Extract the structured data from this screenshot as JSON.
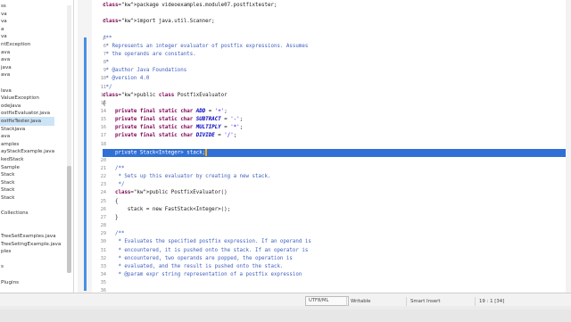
{
  "explorer": {
    "items": [
      {
        "label": "ss",
        "selected": false
      },
      {
        "label": "va",
        "selected": false
      },
      {
        "label": "va",
        "selected": false
      },
      {
        "label": "a",
        "selected": false
      },
      {
        "label": "va",
        "selected": false
      },
      {
        "label": "ntException",
        "selected": false
      },
      {
        "label": "ava",
        "selected": false
      },
      {
        "label": "ava",
        "selected": false
      },
      {
        "label": "java",
        "selected": false
      },
      {
        "label": "ava",
        "selected": false
      },
      {
        "label": "",
        "selected": false
      },
      {
        "label": "Iava",
        "selected": false
      },
      {
        "label": "ValueException",
        "selected": false
      },
      {
        "label": "odeJava",
        "selected": false
      },
      {
        "label": "ostfixEvaluator.java",
        "selected": false
      },
      {
        "label": "ostfixTester.java",
        "selected": true
      },
      {
        "label": "Stackjava",
        "selected": false
      },
      {
        "label": "ava",
        "selected": false
      },
      {
        "label": "amples",
        "selected": false
      },
      {
        "label": "ayStackExample.java",
        "selected": false
      },
      {
        "label": "kedStack",
        "selected": false
      },
      {
        "label": "Sample",
        "selected": false
      },
      {
        "label": "Stack",
        "selected": false
      },
      {
        "label": "Stack",
        "selected": false
      },
      {
        "label": "Stack",
        "selected": false
      },
      {
        "label": "Stack",
        "selected": false
      },
      {
        "label": "",
        "selected": false
      },
      {
        "label": "Collections",
        "selected": false
      },
      {
        "label": "",
        "selected": false
      },
      {
        "label": "",
        "selected": false
      },
      {
        "label": "TreeSetExamples.java",
        "selected": false
      },
      {
        "label": "TreeSetingExample.java",
        "selected": false
      },
      {
        "label": "ples",
        "selected": false
      },
      {
        "label": "",
        "selected": false
      },
      {
        "label": "s",
        "selected": false
      },
      {
        "label": "",
        "selected": false
      },
      {
        "label": "Plugins",
        "selected": false
      }
    ]
  },
  "editor": {
    "line_numbers": [
      "1",
      "",
      "3",
      "",
      "5",
      "6",
      "7",
      "8",
      "9",
      "10",
      "11",
      "12",
      "13",
      "14",
      "15",
      "16",
      "17",
      "18",
      "",
      "20",
      "21",
      "22",
      "23",
      "24",
      "25",
      "26",
      "27",
      "28",
      "29",
      "30",
      "31",
      "32",
      "33",
      "34",
      "35",
      "36"
    ],
    "lines": [
      {
        "text": "package videoexamples.module07.postfixtester;",
        "kind": "pkg"
      },
      {
        "text": "",
        "kind": "plain"
      },
      {
        "text": "import java.util.Scanner;",
        "kind": "imp"
      },
      {
        "text": "",
        "kind": "plain"
      },
      {
        "text": "/**",
        "kind": "jd"
      },
      {
        "text": " * Represents an integer evaluator of postfix expressions. Assumes",
        "kind": "jd"
      },
      {
        "text": " * the operands are constants.",
        "kind": "jd"
      },
      {
        "text": " *",
        "kind": "jd"
      },
      {
        "text": " * @author Java Foundations",
        "kind": "jd"
      },
      {
        "text": " * @version 4.0",
        "kind": "jd"
      },
      {
        "text": " */",
        "kind": "jd"
      },
      {
        "text": "public class PostfixEvaluator",
        "kind": "cls"
      },
      {
        "text": "{",
        "kind": "plain"
      },
      {
        "text": "    private final static char ADD = '+';",
        "kind": "const"
      },
      {
        "text": "    private final static char SUBTRACT = '-';",
        "kind": "const"
      },
      {
        "text": "    private final static char MULTIPLY = '*';",
        "kind": "const"
      },
      {
        "text": "    private final static char DIVIDE = '/';",
        "kind": "const"
      },
      {
        "text": "",
        "kind": "plain"
      },
      {
        "text": "    private Stack<Integer> stack;",
        "kind": "selected"
      },
      {
        "text": "",
        "kind": "plain"
      },
      {
        "text": "    /**",
        "kind": "jd"
      },
      {
        "text": "     * Sets up this evaluator by creating a new stack.",
        "kind": "jd"
      },
      {
        "text": "     */",
        "kind": "jd"
      },
      {
        "text": "    public PostfixEvaluator()",
        "kind": "ctor"
      },
      {
        "text": "    {",
        "kind": "plain"
      },
      {
        "text": "        stack = new FastStack<Integer>();",
        "kind": "plain"
      },
      {
        "text": "    }",
        "kind": "plain"
      },
      {
        "text": "",
        "kind": "plain"
      },
      {
        "text": "    /**",
        "kind": "jd"
      },
      {
        "text": "     * Evaluates the specified postfix expression. If an operand is",
        "kind": "jd"
      },
      {
        "text": "     * encountered, it is pushed onto the stack. If an operator is",
        "kind": "jd"
      },
      {
        "text": "     * encountered, two operands are popped, the operation is",
        "kind": "jd"
      },
      {
        "text": "     * evaluated, and the result is pushed onto the stack.",
        "kind": "jd"
      },
      {
        "text": "     * @param expr string representation of a postfix expression",
        "kind": "jd"
      },
      {
        "text": "",
        "kind": "plain"
      },
      {
        "text": "",
        "kind": "plain"
      }
    ]
  },
  "statusbar": {
    "combo": "UTF8/ML",
    "writable": "Writable",
    "insert_mode": "Smart Insert",
    "cursor": "19 : 1 [34]"
  },
  "colors": {
    "selection": "#2f6fd6",
    "keyword": "#7f0055",
    "javadoc": "#3f5fbf",
    "ruler_mark": "#4a90e2"
  }
}
